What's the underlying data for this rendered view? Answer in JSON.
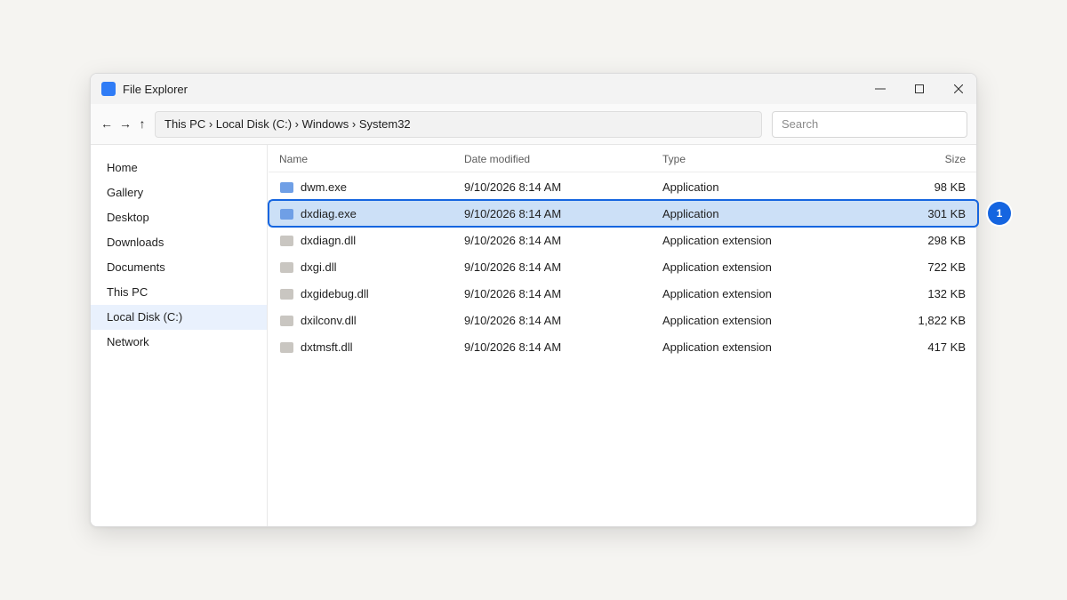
{
  "window": {
    "title": "File Explorer",
    "controls": {
      "minimize": "minimize-icon",
      "maximize": "maximize-icon",
      "close": "close-icon"
    }
  },
  "toolbar": {
    "back": "←",
    "forward": "→",
    "up": "↑",
    "breadcrumb": "This PC › Local Disk (C:) › Windows › System32",
    "search_placeholder": "Search"
  },
  "sidebar": {
    "items": [
      {
        "label": "Home"
      },
      {
        "label": "Gallery"
      },
      {
        "label": "Desktop"
      },
      {
        "label": "Downloads"
      },
      {
        "label": "Documents"
      },
      {
        "label": "This PC"
      },
      {
        "label": "Local Disk (C:)",
        "active": true
      },
      {
        "label": "Network"
      }
    ]
  },
  "columns": {
    "name": "Name",
    "date": "Date modified",
    "type": "Type",
    "size": "Size"
  },
  "files": [
    {
      "name": "dwm.exe",
      "date": "9/10/2026 8:14 AM",
      "type": "Application",
      "size": "98 KB",
      "icon": "exe-file-icon",
      "color": "#6f9fe6"
    },
    {
      "name": "dxdiag.exe",
      "date": "9/10/2026 8:14 AM",
      "type": "Application",
      "size": "301 KB",
      "icon": "exe-file-icon",
      "color": "#6f9fe6",
      "selected": true
    },
    {
      "name": "dxdiagn.dll",
      "date": "9/10/2026 8:14 AM",
      "type": "Application extension",
      "size": "298 KB",
      "icon": "dll-file-icon",
      "color": "#c9c6c1"
    },
    {
      "name": "dxgi.dll",
      "date": "9/10/2026 8:14 AM",
      "type": "Application extension",
      "size": "722 KB",
      "icon": "dll-file-icon",
      "color": "#c9c6c1"
    },
    {
      "name": "dxgidebug.dll",
      "date": "9/10/2026 8:14 AM",
      "type": "Application extension",
      "size": "132 KB",
      "icon": "dll-file-icon",
      "color": "#c9c6c1"
    },
    {
      "name": "dxilconv.dll",
      "date": "9/10/2026 8:14 AM",
      "type": "Application extension",
      "size": "1,822 KB",
      "icon": "dll-file-icon",
      "color": "#c9c6c1"
    },
    {
      "name": "dxtmsft.dll",
      "date": "9/10/2026 8:14 AM",
      "type": "Application extension",
      "size": "417 KB",
      "icon": "dll-file-icon",
      "color": "#c9c6c1"
    }
  ],
  "annotation": {
    "badge": "1",
    "accent": "#1565e0"
  }
}
